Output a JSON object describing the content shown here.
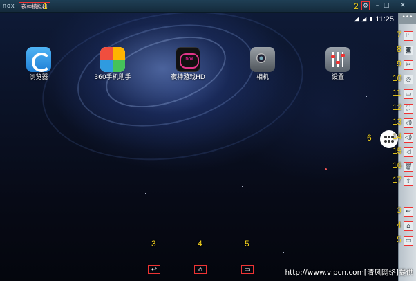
{
  "titlebar": {
    "logo": "nox",
    "title": "夜神模拟器",
    "settings_icon": "⚙",
    "minimize_icon": "–",
    "maximize_icon": "□",
    "close_icon": "✕"
  },
  "statusbar": {
    "wifi_icon": "◢",
    "signal_icon": "◢",
    "battery_icon": "▮",
    "time": "11:25"
  },
  "apps": [
    {
      "label": "浏览器"
    },
    {
      "label": "360手机助手"
    },
    {
      "label": "夜神游戏HD"
    },
    {
      "label": "相机"
    },
    {
      "label": "设置"
    }
  ],
  "nav": {
    "back_icon": "↩",
    "home_icon": "⌂",
    "recent_icon": "▭"
  },
  "toolbar": {
    "handle_icon": "•••",
    "buttons": [
      "⍞",
      "◙",
      "✂",
      "◎",
      "▭",
      "⛶",
      "◁)",
      "◁)",
      "◁",
      "🗑",
      "⇪",
      "↩",
      "⌂",
      "▭"
    ]
  },
  "annotations": [
    "1",
    "2",
    "3",
    "4",
    "5",
    "6",
    "7",
    "8",
    "9",
    "10",
    "11",
    "12",
    "13",
    "14",
    "15",
    "16",
    "17",
    "3",
    "4",
    "5"
  ],
  "watermark": "http://www.vipcn.com[清风网络]提供",
  "colors": {
    "highlight": "#ee3333",
    "annotation": "#f3d11d"
  }
}
